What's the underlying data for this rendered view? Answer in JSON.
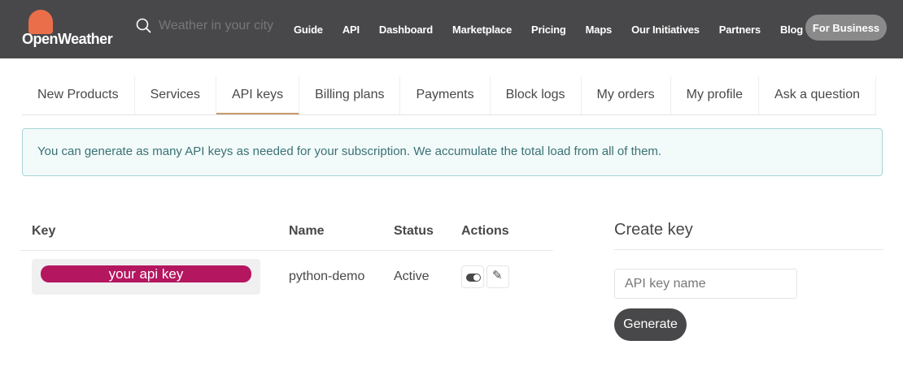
{
  "header": {
    "logo": "OpenWeather",
    "search_placeholder": "Weather in your city",
    "nav": [
      "Guide",
      "API",
      "Dashboard",
      "Marketplace",
      "Pricing",
      "Maps",
      "Our Initiatives",
      "Partners",
      "Blog"
    ],
    "business_button": "For Business"
  },
  "tabs": [
    "New Products",
    "Services",
    "API keys",
    "Billing plans",
    "Payments",
    "Block logs",
    "My orders",
    "My profile",
    "Ask a question"
  ],
  "active_tab": "API keys",
  "alert": "You can generate as many API keys as needed for your subscription. We accumulate the total load from all of them.",
  "keys_table": {
    "columns": [
      "Key",
      "Name",
      "Status",
      "Actions"
    ],
    "rows": [
      {
        "key": "your api key",
        "name": "python-demo",
        "status": "Active"
      }
    ]
  },
  "create_key": {
    "title": "Create key",
    "placeholder": "API key name",
    "button": "Generate"
  },
  "colors": {
    "header_bg": "#48484a",
    "key_highlight": "#b51660",
    "logo": "#eb6e4b"
  }
}
